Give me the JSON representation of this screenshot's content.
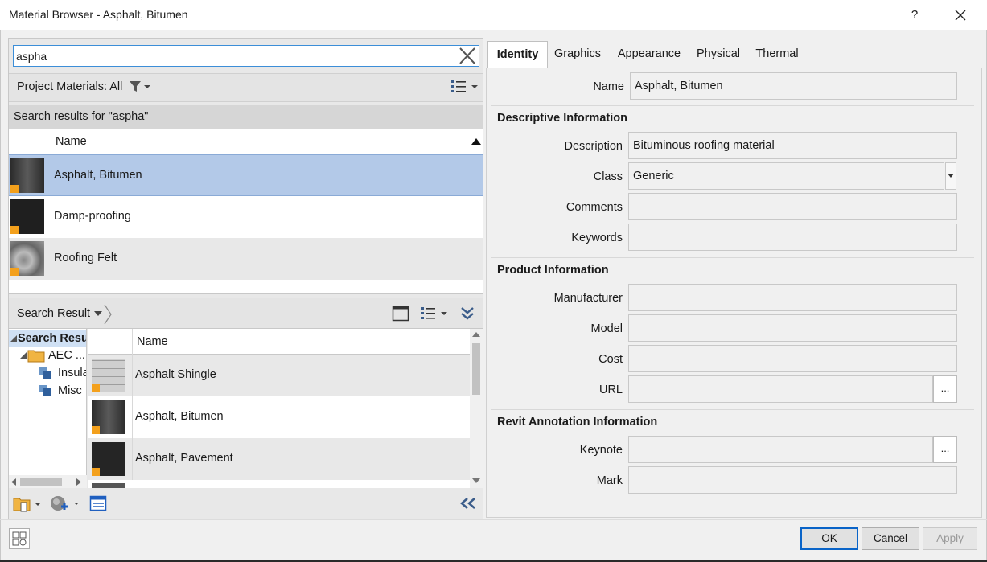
{
  "window": {
    "title": "Material Browser - Asphalt, Bitumen",
    "help_label": "?",
    "close_label": "×"
  },
  "search": {
    "value": "aspha"
  },
  "filter": {
    "label": "Project Materials: All"
  },
  "results": {
    "header": "Search results for \"aspha\"",
    "column_name": "Name",
    "items": [
      {
        "label": "Asphalt, Bitumen",
        "selected": true
      },
      {
        "label": "Damp-proofing",
        "selected": false
      },
      {
        "label": "Roofing Felt",
        "selected": false
      }
    ]
  },
  "library": {
    "bar_label": "Search Result",
    "tree": {
      "root": "Search Resu",
      "folder": "AEC ...",
      "children": [
        "Insula",
        "Misc"
      ]
    },
    "column_name": "Name",
    "items": [
      "Asphalt Shingle",
      "Asphalt, Bitumen",
      "Asphalt, Pavement"
    ]
  },
  "tabs": [
    {
      "label": "Identity",
      "active": true
    },
    {
      "label": "Graphics"
    },
    {
      "label": "Appearance"
    },
    {
      "label": "Physical"
    },
    {
      "label": "Thermal"
    }
  ],
  "identity": {
    "name_label": "Name",
    "name_value": "Asphalt, Bitumen",
    "descriptive": {
      "heading": "Descriptive Information",
      "description_label": "Description",
      "description_value": "Bituminous roofing material",
      "class_label": "Class",
      "class_value": "Generic",
      "comments_label": "Comments",
      "comments_value": "",
      "keywords_label": "Keywords",
      "keywords_value": ""
    },
    "product": {
      "heading": "Product Information",
      "manufacturer_label": "Manufacturer",
      "model_label": "Model",
      "cost_label": "Cost",
      "url_label": "URL",
      "browse_label": "..."
    },
    "annotation": {
      "heading": "Revit Annotation Information",
      "keynote_label": "Keynote",
      "mark_label": "Mark",
      "browse_label": "..."
    }
  },
  "footer": {
    "ok": "OK",
    "cancel": "Cancel",
    "apply": "Apply"
  },
  "colors": {
    "selection": "#b3c9e8",
    "accent": "#0a64c8",
    "warning": "#f3a01c"
  }
}
